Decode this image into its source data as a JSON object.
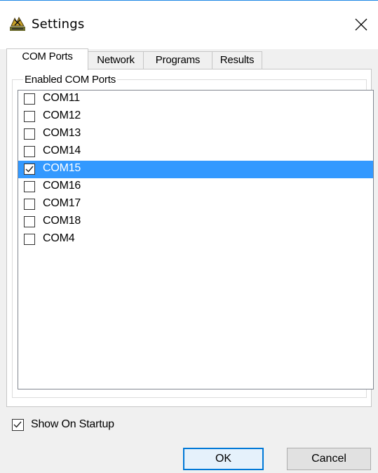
{
  "window": {
    "title": "Settings",
    "icon": "settings-app-icon",
    "close_icon": "close-icon"
  },
  "tabs": [
    {
      "label": "COM Ports",
      "active": true
    },
    {
      "label": "Network",
      "active": false
    },
    {
      "label": "Programs",
      "active": false
    },
    {
      "label": "Results",
      "active": false
    }
  ],
  "group": {
    "label": "Enabled COM Ports"
  },
  "ports": [
    {
      "label": "COM11",
      "checked": false,
      "selected": false
    },
    {
      "label": "COM12",
      "checked": false,
      "selected": false
    },
    {
      "label": "COM13",
      "checked": false,
      "selected": false
    },
    {
      "label": "COM14",
      "checked": false,
      "selected": false
    },
    {
      "label": "COM15",
      "checked": true,
      "selected": true
    },
    {
      "label": "COM16",
      "checked": false,
      "selected": false
    },
    {
      "label": "COM17",
      "checked": false,
      "selected": false
    },
    {
      "label": "COM18",
      "checked": false,
      "selected": false
    },
    {
      "label": "COM4",
      "checked": false,
      "selected": false
    }
  ],
  "startup": {
    "label": "Show On Startup",
    "checked": true
  },
  "buttons": {
    "ok": "OK",
    "cancel": "Cancel"
  },
  "colors": {
    "selection": "#3399ff",
    "accent": "#0078d7"
  }
}
